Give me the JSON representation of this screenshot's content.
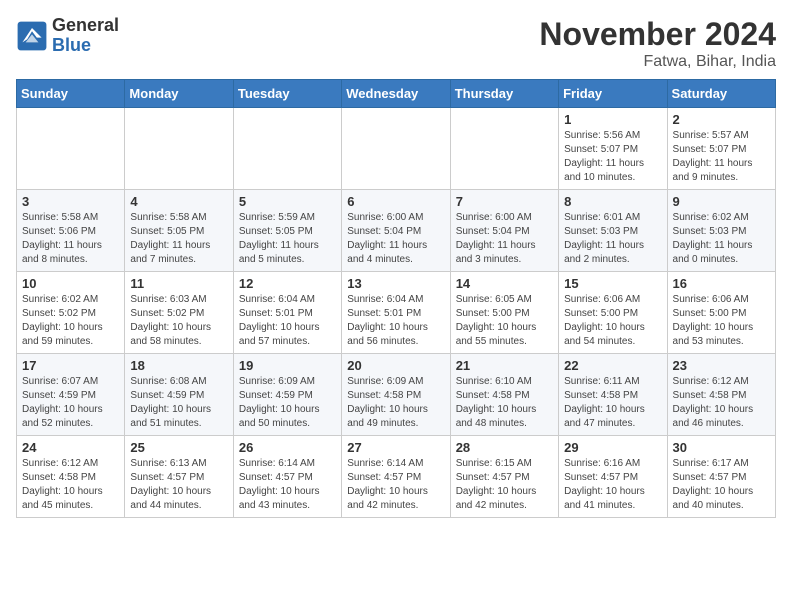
{
  "logo": {
    "general": "General",
    "blue": "Blue"
  },
  "header": {
    "month": "November 2024",
    "location": "Fatwa, Bihar, India"
  },
  "weekdays": [
    "Sunday",
    "Monday",
    "Tuesday",
    "Wednesday",
    "Thursday",
    "Friday",
    "Saturday"
  ],
  "weeks": [
    [
      {
        "day": "",
        "info": ""
      },
      {
        "day": "",
        "info": ""
      },
      {
        "day": "",
        "info": ""
      },
      {
        "day": "",
        "info": ""
      },
      {
        "day": "",
        "info": ""
      },
      {
        "day": "1",
        "info": "Sunrise: 5:56 AM\nSunset: 5:07 PM\nDaylight: 11 hours and 10 minutes."
      },
      {
        "day": "2",
        "info": "Sunrise: 5:57 AM\nSunset: 5:07 PM\nDaylight: 11 hours and 9 minutes."
      }
    ],
    [
      {
        "day": "3",
        "info": "Sunrise: 5:58 AM\nSunset: 5:06 PM\nDaylight: 11 hours and 8 minutes."
      },
      {
        "day": "4",
        "info": "Sunrise: 5:58 AM\nSunset: 5:05 PM\nDaylight: 11 hours and 7 minutes."
      },
      {
        "day": "5",
        "info": "Sunrise: 5:59 AM\nSunset: 5:05 PM\nDaylight: 11 hours and 5 minutes."
      },
      {
        "day": "6",
        "info": "Sunrise: 6:00 AM\nSunset: 5:04 PM\nDaylight: 11 hours and 4 minutes."
      },
      {
        "day": "7",
        "info": "Sunrise: 6:00 AM\nSunset: 5:04 PM\nDaylight: 11 hours and 3 minutes."
      },
      {
        "day": "8",
        "info": "Sunrise: 6:01 AM\nSunset: 5:03 PM\nDaylight: 11 hours and 2 minutes."
      },
      {
        "day": "9",
        "info": "Sunrise: 6:02 AM\nSunset: 5:03 PM\nDaylight: 11 hours and 0 minutes."
      }
    ],
    [
      {
        "day": "10",
        "info": "Sunrise: 6:02 AM\nSunset: 5:02 PM\nDaylight: 10 hours and 59 minutes."
      },
      {
        "day": "11",
        "info": "Sunrise: 6:03 AM\nSunset: 5:02 PM\nDaylight: 10 hours and 58 minutes."
      },
      {
        "day": "12",
        "info": "Sunrise: 6:04 AM\nSunset: 5:01 PM\nDaylight: 10 hours and 57 minutes."
      },
      {
        "day": "13",
        "info": "Sunrise: 6:04 AM\nSunset: 5:01 PM\nDaylight: 10 hours and 56 minutes."
      },
      {
        "day": "14",
        "info": "Sunrise: 6:05 AM\nSunset: 5:00 PM\nDaylight: 10 hours and 55 minutes."
      },
      {
        "day": "15",
        "info": "Sunrise: 6:06 AM\nSunset: 5:00 PM\nDaylight: 10 hours and 54 minutes."
      },
      {
        "day": "16",
        "info": "Sunrise: 6:06 AM\nSunset: 5:00 PM\nDaylight: 10 hours and 53 minutes."
      }
    ],
    [
      {
        "day": "17",
        "info": "Sunrise: 6:07 AM\nSunset: 4:59 PM\nDaylight: 10 hours and 52 minutes."
      },
      {
        "day": "18",
        "info": "Sunrise: 6:08 AM\nSunset: 4:59 PM\nDaylight: 10 hours and 51 minutes."
      },
      {
        "day": "19",
        "info": "Sunrise: 6:09 AM\nSunset: 4:59 PM\nDaylight: 10 hours and 50 minutes."
      },
      {
        "day": "20",
        "info": "Sunrise: 6:09 AM\nSunset: 4:58 PM\nDaylight: 10 hours and 49 minutes."
      },
      {
        "day": "21",
        "info": "Sunrise: 6:10 AM\nSunset: 4:58 PM\nDaylight: 10 hours and 48 minutes."
      },
      {
        "day": "22",
        "info": "Sunrise: 6:11 AM\nSunset: 4:58 PM\nDaylight: 10 hours and 47 minutes."
      },
      {
        "day": "23",
        "info": "Sunrise: 6:12 AM\nSunset: 4:58 PM\nDaylight: 10 hours and 46 minutes."
      }
    ],
    [
      {
        "day": "24",
        "info": "Sunrise: 6:12 AM\nSunset: 4:58 PM\nDaylight: 10 hours and 45 minutes."
      },
      {
        "day": "25",
        "info": "Sunrise: 6:13 AM\nSunset: 4:57 PM\nDaylight: 10 hours and 44 minutes."
      },
      {
        "day": "26",
        "info": "Sunrise: 6:14 AM\nSunset: 4:57 PM\nDaylight: 10 hours and 43 minutes."
      },
      {
        "day": "27",
        "info": "Sunrise: 6:14 AM\nSunset: 4:57 PM\nDaylight: 10 hours and 42 minutes."
      },
      {
        "day": "28",
        "info": "Sunrise: 6:15 AM\nSunset: 4:57 PM\nDaylight: 10 hours and 42 minutes."
      },
      {
        "day": "29",
        "info": "Sunrise: 6:16 AM\nSunset: 4:57 PM\nDaylight: 10 hours and 41 minutes."
      },
      {
        "day": "30",
        "info": "Sunrise: 6:17 AM\nSunset: 4:57 PM\nDaylight: 10 hours and 40 minutes."
      }
    ]
  ]
}
